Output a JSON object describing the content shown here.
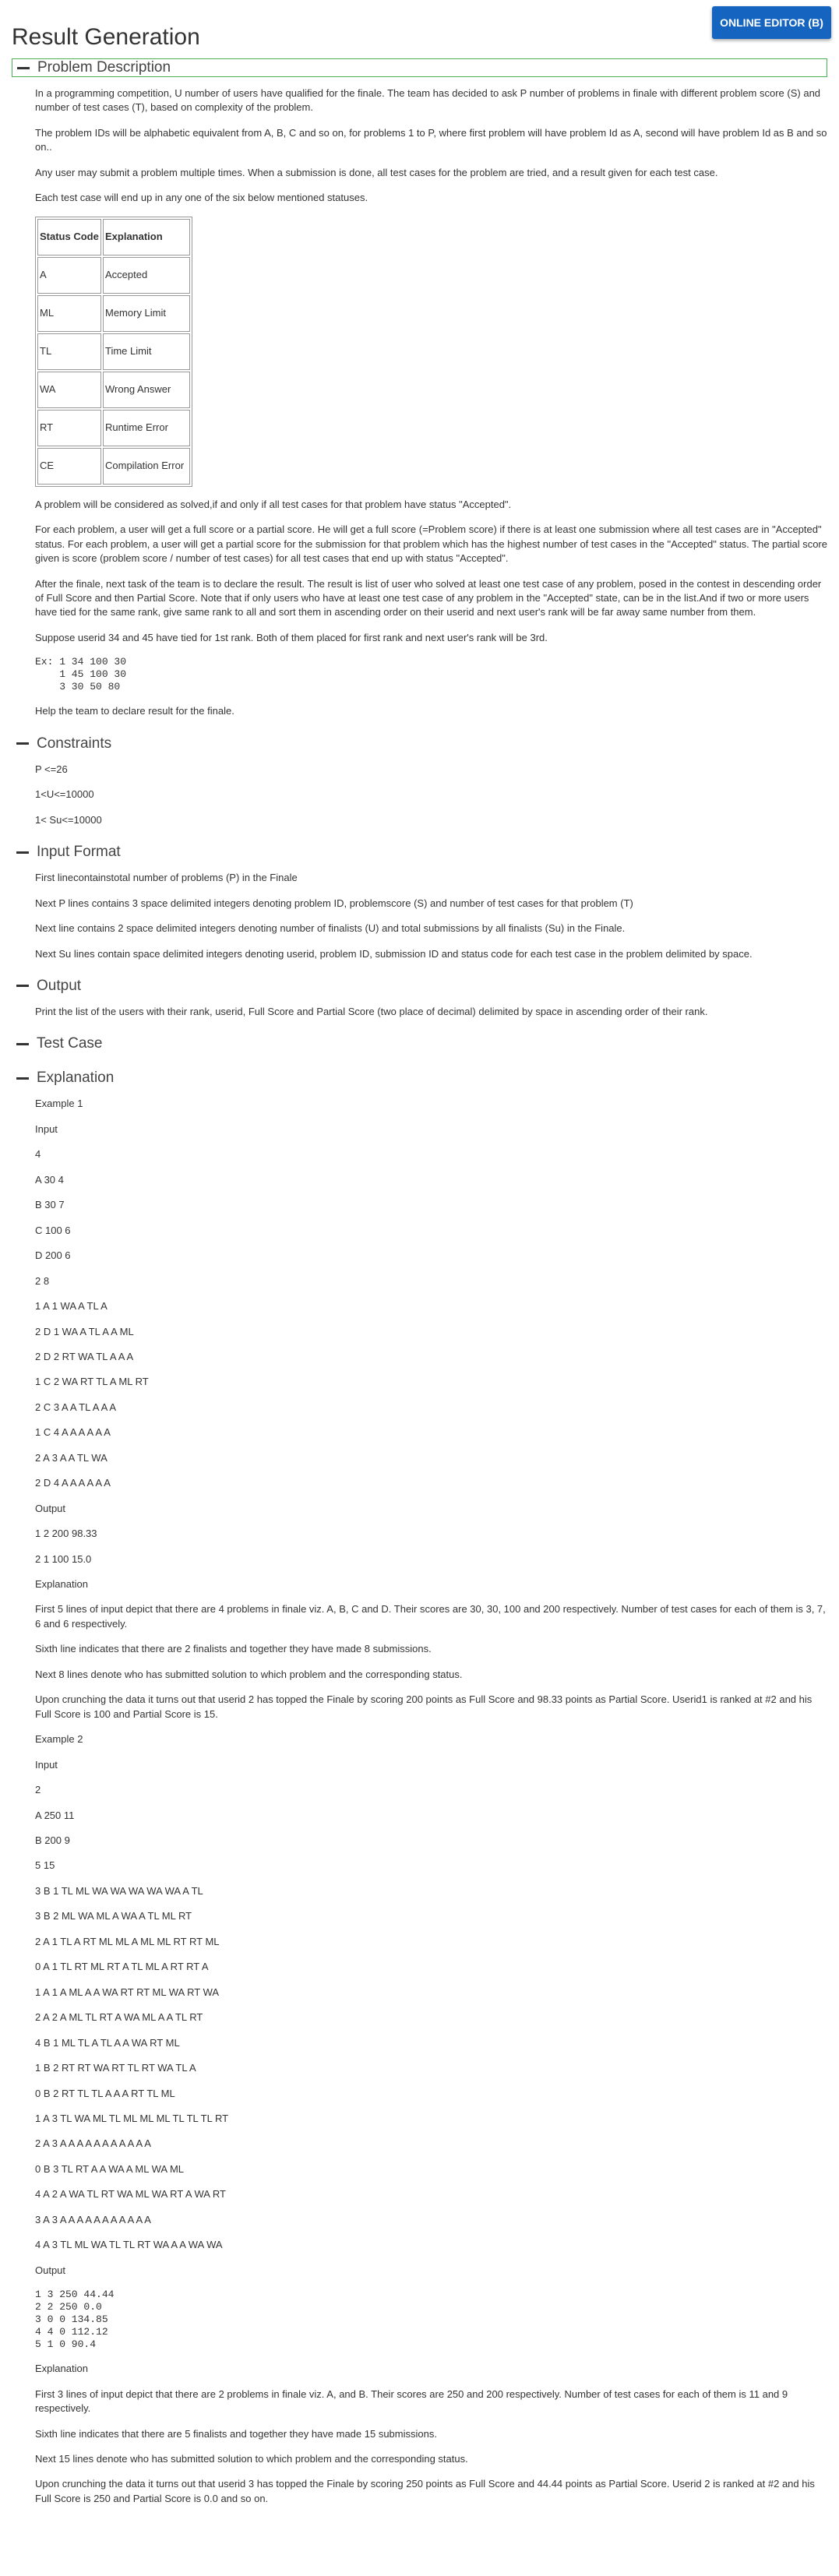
{
  "header": {
    "title": "Result Generation",
    "editor_button": "ONLINE EDITOR (B)"
  },
  "problem_description": {
    "heading": "Problem Description",
    "paragraphs_before_table": [
      "In a programming competition, U number of users have qualified for the finale. The team has decided to ask P number of problems in finale with different problem score (S) and number of test cases (T), based on complexity of the problem.",
      "The problem IDs will be alphabetic equivalent from A, B, C and so on, for problems 1 to P, where first problem will have problem Id as A, second will have problem Id as B and so on..",
      "Any user may submit a problem multiple times. When a submission is done, all test cases for the problem are tried, and a result given for each test case.",
      "Each test case will end up in any one of the six below mentioned statuses."
    ],
    "table": {
      "headers": [
        "Status Code",
        "Explanation"
      ],
      "rows": [
        [
          "A",
          "Accepted"
        ],
        [
          "ML",
          "Memory Limit"
        ],
        [
          "TL",
          "Time Limit"
        ],
        [
          "WA",
          "Wrong Answer"
        ],
        [
          "RT",
          "Runtime Error"
        ],
        [
          "CE",
          "Compilation Error"
        ]
      ]
    },
    "paragraphs_after_table": [
      "A problem will be considered as solved,if and only if all test cases for that problem have status \"Accepted\".",
      "For each problem, a user will get a full score or a partial score. He will get a full score (=Problem score) if there is at least one submission where all test cases are in \"Accepted\" status. For each problem, a user will get a partial score for the submission for that problem which has the highest number of test cases in the \"Accepted\" status. The partial score given is score (problem score / number of test cases) for all test cases that end up with status \"Accepted\".",
      "After the finale, next task of the team is to declare the result. The result is list of user who solved at least one test case of any problem, posed in the contest in descending order of Full Score and then Partial Score. Note that if only users who have at least one test case of any problem in the \"Accepted\" state, can be in the list.And if two or more users have tied for the same rank, give same rank to all and sort them in ascending order on their userid and next user's rank will be far away same number from them.",
      "Suppose userid 34 and 45 have tied for 1st rank. Both of them placed for first rank and next user's rank will be 3rd."
    ],
    "example_block": "Ex: 1 34 100 30\n    1 45 100 30\n    3 30 50 80",
    "closing": "Help the team to declare result for the finale."
  },
  "constraints": {
    "heading": "Constraints",
    "items": [
      "P <=26",
      "1<U<=10000",
      "1< Su<=10000"
    ]
  },
  "input_format": {
    "heading": "Input Format",
    "items": [
      "First linecontainstotal number of problems (P) in the Finale",
      "Next P lines contains 3 space delimited integers denoting problem ID, problemscore (S) and number of test cases for that problem (T)",
      "Next line contains 2 space delimited integers denoting number of finalists (U) and total submissions by all finalists (Su) in the Finale.",
      "Next Su lines contain space delimited integers denoting userid, problem ID, submission ID and status code for each test case in the problem delimited by space."
    ]
  },
  "output": {
    "heading": "Output",
    "items": [
      "Print the list of the users with their rank, userid, Full Score and Partial Score (two place of decimal) delimited by space in ascending order of their rank."
    ]
  },
  "test_case": {
    "heading": "Test Case"
  },
  "explanation": {
    "heading": "Explanation",
    "example1": {
      "label": "Example 1",
      "input_label": "Input",
      "input_lines": [
        "4",
        "A 30 4",
        "B 30 7",
        "C 100 6",
        "D 200 6",
        "2 8",
        "1 A 1 WA A TL A",
        "2 D 1 WA A TL A A ML",
        "2 D 2 RT WA TL A A A",
        "1 C 2 WA RT TL A ML RT",
        "2 C 3 A A TL A A A",
        "1 C 4 A A A A A A",
        "2 A 3 A A TL WA",
        "2 D 4 A A A A A A"
      ],
      "output_label": "Output",
      "output_lines": [
        "1 2 200 98.33",
        "2 1 100 15.0"
      ],
      "explanation_label": "Explanation",
      "explanation_paragraphs": [
        "First 5 lines of input depict that there are 4 problems in finale viz. A, B, C and D. Their scores are 30, 30, 100 and 200 respectively. Number of test cases for each of them is 3, 7, 6 and 6 respectively.",
        "Sixth line indicates that there are 2 finalists and together they have made 8 submissions.",
        "Next 8 lines denote who has submitted solution to which problem and the corresponding status.",
        "Upon crunching the data it turns out that userid 2 has topped the Finale by scoring 200 points as Full Score and 98.33 points as Partial Score. Userid1 is ranked at #2 and his Full Score is 100 and Partial Score is 15."
      ]
    },
    "example2": {
      "label": "Example 2",
      "input_label": "Input",
      "input_lines": [
        "2",
        "A 250 11",
        "B 200 9",
        "5 15",
        "3 B 1 TL ML WA WA WA WA WA A TL",
        "3 B 2 ML WA ML A WA A TL ML RT",
        "2 A 1 TL A RT ML ML A ML ML RT RT ML",
        "0 A 1 TL RT ML RT A TL ML A RT RT A",
        "1 A 1 A ML A A WA RT RT ML WA RT WA",
        "2 A 2 A ML TL RT A WA ML A A TL RT",
        "4 B 1 ML TL A TL A A WA RT ML",
        "1 B 2 RT RT WA RT TL RT WA TL A",
        "0 B 2 RT TL TL A A A RT TL ML",
        "1 A 3 TL WA ML TL ML ML ML TL TL TL RT",
        "2 A 3 A A A A A A A A A A A",
        "0 B 3 TL RT A A WA A ML WA ML",
        "4 A 2 A WA TL RT WA ML WA RT A WA RT",
        "3 A 3 A A A A A A A A A A A",
        "4 A 3 TL ML WA TL TL RT WA A A WA WA"
      ],
      "output_label": "Output",
      "output_block": "1 3 250 44.44\n2 2 250 0.0\n3 0 0 134.85\n4 4 0 112.12\n5 1 0 90.4",
      "explanation_label": "Explanation",
      "explanation_paragraphs": [
        "First 3 lines of input depict that there are 2 problems in finale viz. A, and B. Their scores are 250 and 200 respectively. Number of test cases for each of them is 11 and 9 respectively.",
        "Sixth line indicates that there are 5 finalists and together they have made 15 submissions.",
        "Next 15 lines denote who has submitted solution to which problem and the corresponding status.",
        "Upon crunching the data it turns out that userid 3 has topped the Finale by scoring 250 points as Full Score and 44.44 points as Partial Score. Userid 2 is ranked at #2 and his Full Score is 250 and Partial Score is 0.0 and so on."
      ]
    }
  },
  "colors": {
    "button_bg": "#1565c0",
    "focus_outline": "#4caf50",
    "text": "#333333"
  }
}
